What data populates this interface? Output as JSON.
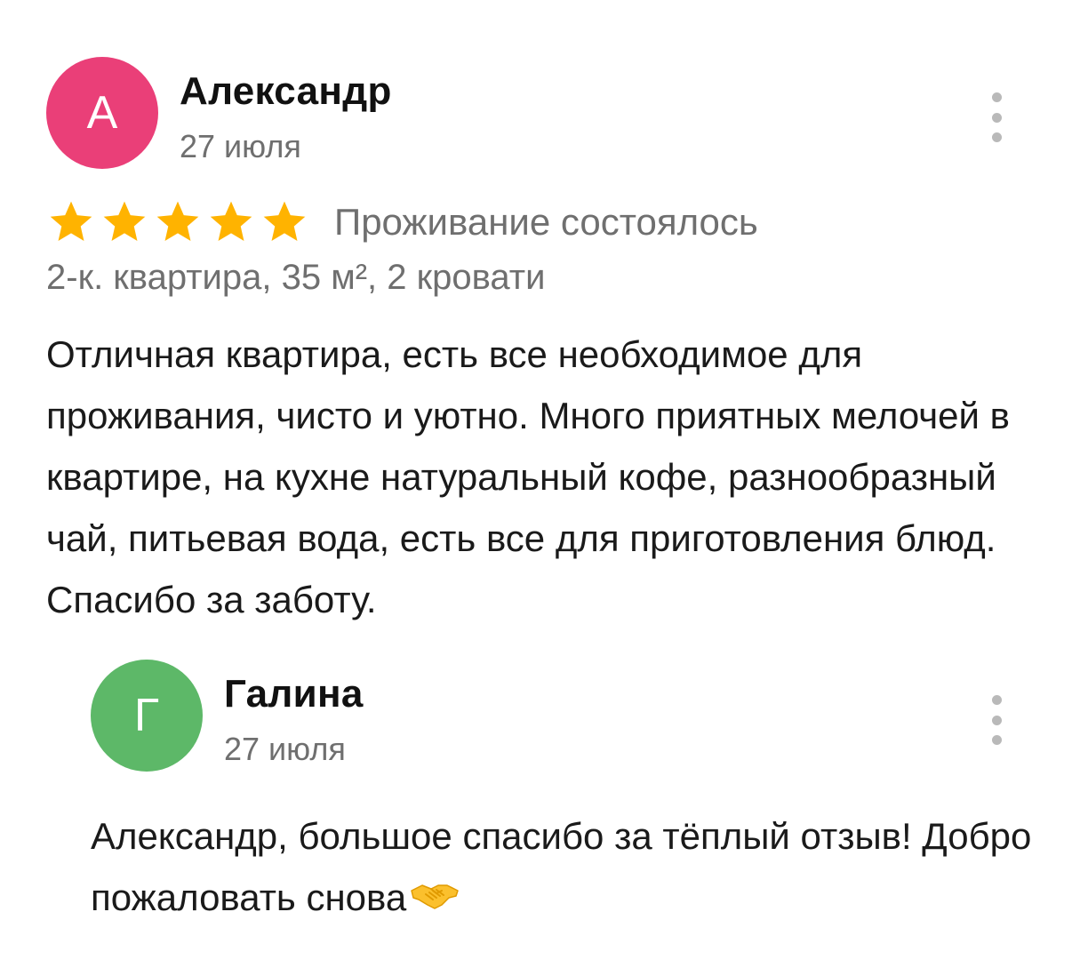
{
  "review": {
    "avatar_letter": "А",
    "avatar_color": "#ea3f78",
    "author": "Александр",
    "date": "27 июля",
    "rating": 5,
    "rating_max": 5,
    "star_color": "#ffb300",
    "stay_status": "Проживание состоялось",
    "apartment": "2-к. квартира, 35 м², 2 кровати",
    "text": "Отличная квартира, есть все необходимое для проживания, чисто и уютно. Много приятных мелочей в квартире, на кухне натуральный кофе, разнообразный чай, питьевая вода, есть все для приготовления блюд. Спасибо за заботу.",
    "menu_icon": "more-vertical-icon"
  },
  "reply": {
    "avatar_letter": "Г",
    "avatar_color": "#5db868",
    "author": "Галина",
    "date": "27 июля",
    "text": "Александр, большое спасибо за тёплый отзыв! Добро пожаловать снова",
    "emoji_icon": "handshake-emoji",
    "menu_icon": "more-vertical-icon"
  }
}
